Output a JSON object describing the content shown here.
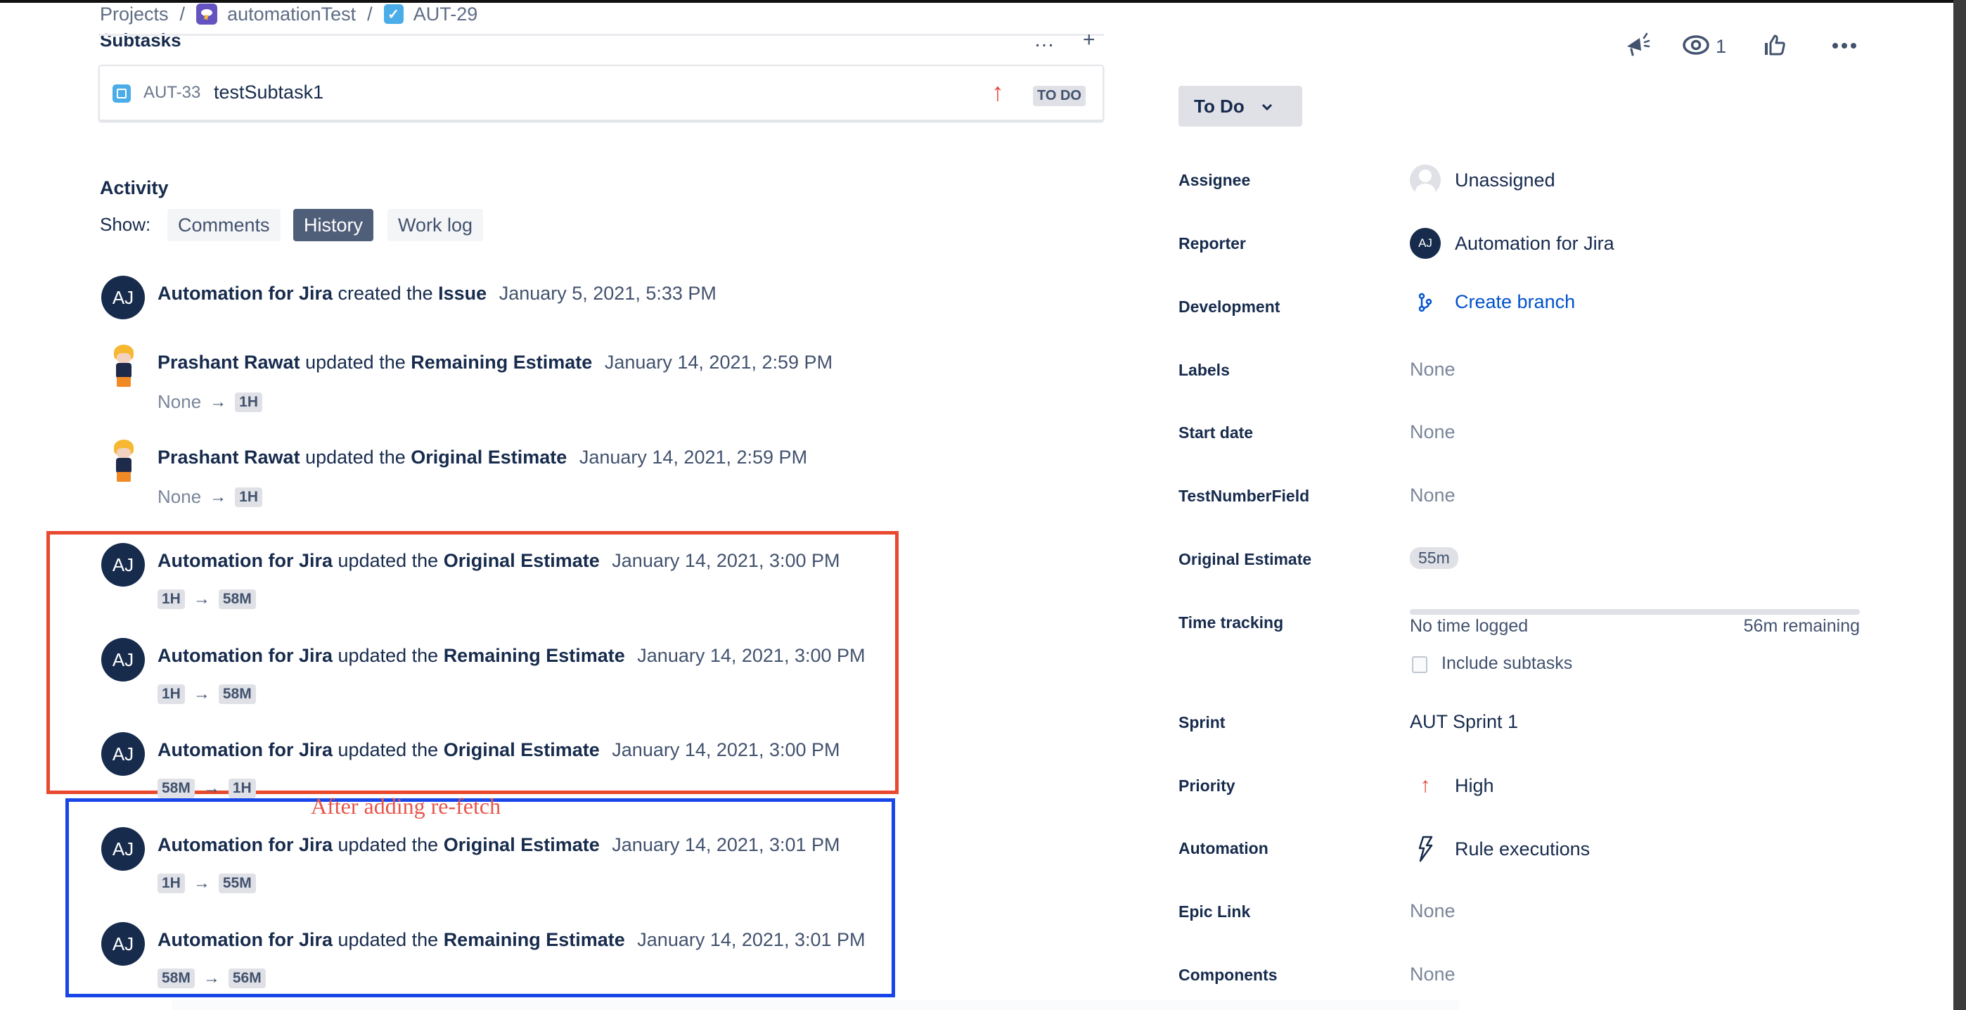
{
  "breadcrumb": {
    "items": [
      "Projects",
      "automationTest",
      "AUT-29"
    ],
    "separator": "/"
  },
  "subtasks": {
    "title": "Subtasks",
    "more_icon": "…",
    "add_icon": "+",
    "items": [
      {
        "key": "AUT-33",
        "summary": "testSubtask1",
        "priority": "high",
        "priority_glyph": "↑",
        "status": "TO DO"
      }
    ]
  },
  "activity": {
    "title": "Activity",
    "show_label": "Show:",
    "tabs": [
      {
        "label": "Comments",
        "active": false
      },
      {
        "label": "History",
        "active": true
      },
      {
        "label": "Work log",
        "active": false
      }
    ],
    "arrow": "→",
    "entries": [
      {
        "author": "Automation for Jira",
        "initials": "AJ",
        "action": "created the",
        "field": "Issue",
        "date": "January 5, 2021, 5:33 PM"
      },
      {
        "author": "Prashant Rawat",
        "initials": "",
        "action": "updated the",
        "field": "Remaining Estimate",
        "date": "January 14, 2021, 2:59 PM",
        "from": "None",
        "to": "1H"
      },
      {
        "author": "Prashant Rawat",
        "initials": "",
        "action": "updated the",
        "field": "Original Estimate",
        "date": "January 14, 2021, 2:59 PM",
        "from": "None",
        "to": "1H"
      },
      {
        "author": "Automation for Jira",
        "initials": "AJ",
        "action": "updated the",
        "field": "Original Estimate",
        "date": "January 14, 2021, 3:00 PM",
        "from": "1H",
        "to": "58M"
      },
      {
        "author": "Automation for Jira",
        "initials": "AJ",
        "action": "updated the",
        "field": "Remaining Estimate",
        "date": "January 14, 2021, 3:00 PM",
        "from": "1H",
        "to": "58M"
      },
      {
        "author": "Automation for Jira",
        "initials": "AJ",
        "action": "updated the",
        "field": "Original Estimate",
        "date": "January 14, 2021, 3:00 PM",
        "from": "58M",
        "to": "1H"
      },
      {
        "author": "Automation for Jira",
        "initials": "AJ",
        "action": "updated the",
        "field": "Original Estimate",
        "date": "January 14, 2021, 3:01 PM",
        "from": "1H",
        "to": "55M"
      },
      {
        "author": "Automation for Jira",
        "initials": "AJ",
        "action": "updated the",
        "field": "Remaining Estimate",
        "date": "January 14, 2021, 3:01 PM",
        "from": "58M",
        "to": "56M"
      }
    ]
  },
  "annotation": {
    "text": "After adding re-fetch",
    "red_box_color": "#e8492f",
    "blue_box_color": "#1745e8"
  },
  "top_actions": {
    "watch_count": "1",
    "icons": [
      "megaphone-icon",
      "eye-icon",
      "thumbs-up-icon",
      "more-icon"
    ]
  },
  "status": {
    "label": "To Do"
  },
  "fields": {
    "assignee": {
      "label": "Assignee",
      "value": "Unassigned"
    },
    "reporter": {
      "label": "Reporter",
      "value": "Automation for Jira",
      "initials": "AJ"
    },
    "development": {
      "label": "Development",
      "value": "Create branch"
    },
    "labels": {
      "label": "Labels",
      "value": "None"
    },
    "start_date": {
      "label": "Start date",
      "value": "None"
    },
    "test_number": {
      "label": "TestNumberField",
      "value": "None"
    },
    "original_estimate": {
      "label": "Original Estimate",
      "value": "55m"
    },
    "time_tracking": {
      "label": "Time tracking",
      "logged": "No time logged",
      "remaining": "56m remaining",
      "logged_fraction": 0,
      "include_subtasks": "Include subtasks",
      "include_checked": false
    },
    "sprint": {
      "label": "Sprint",
      "value": "AUT Sprint 1"
    },
    "priority": {
      "label": "Priority",
      "value": "High"
    },
    "automation": {
      "label": "Automation",
      "value": "Rule executions"
    },
    "epic_link": {
      "label": "Epic Link",
      "value": "None"
    },
    "components": {
      "label": "Components",
      "value": "None"
    }
  },
  "colors": {
    "link": "#0052cc",
    "priority_high": "#e5493a",
    "active_tab": "#505f79"
  }
}
